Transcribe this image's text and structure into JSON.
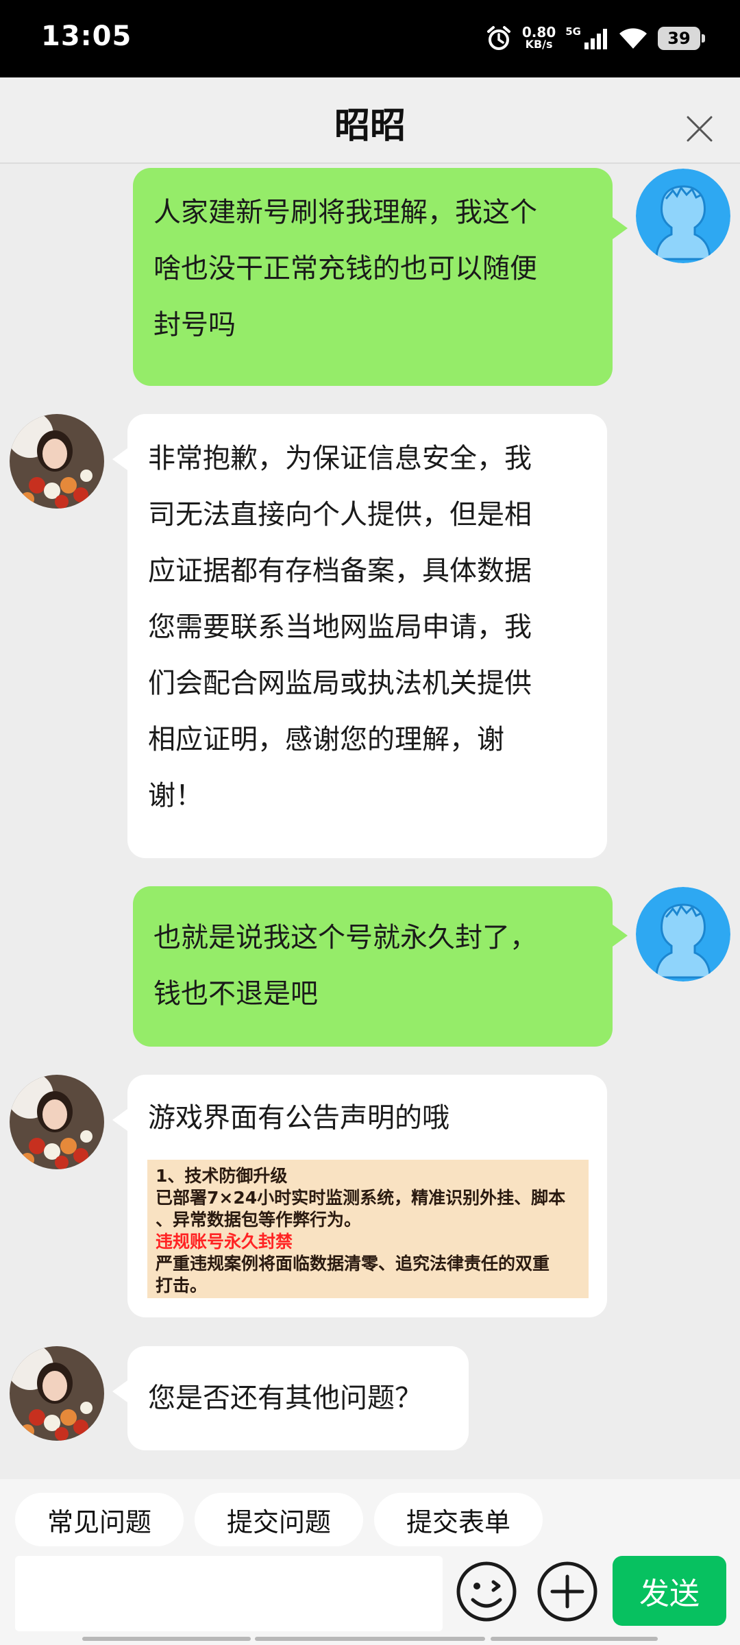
{
  "status_bar": {
    "time": "13:05",
    "net_speed_value": "0.80",
    "net_speed_unit": "KB/s",
    "network_type": "5G",
    "battery": "39"
  },
  "header": {
    "title": "昭昭"
  },
  "messages": [
    {
      "side": "me",
      "lines": [
        "人家建新号刷将我理解，我这个",
        "啥也没干正常充钱的也可以随便",
        "封号吗"
      ]
    },
    {
      "side": "them",
      "lines": [
        "非常抱歉，为保证信息安全，我",
        "司无法直接向个人提供，但是相",
        "应证据都有存档备案，具体数据",
        "您需要联系当地网监局申请，我",
        "们会配合网监局或执法机关提供",
        "相应证明，感谢您的理解，谢",
        "谢！"
      ]
    },
    {
      "side": "me",
      "lines": [
        "也就是说我这个号就永久封了，",
        "钱也不退是吧"
      ]
    },
    {
      "side": "them",
      "lines": [
        "游戏界面有公告声明的哦"
      ],
      "notice": {
        "line1": "1、技术防御升级",
        "line2": "已部署7×24小时实时监测系统，精准识别外挂、脚本",
        "line3": "、异常数据包等作弊行为。",
        "line4": "违规账号永久封禁",
        "line5": "严重违规案例将面临数据清零、追究法律责任的双重",
        "line6": "打击。"
      }
    },
    {
      "side": "them",
      "lines": [
        "您是否还有其他问题？"
      ]
    }
  ],
  "quick_actions": [
    "常见问题",
    "提交问题",
    "提交表单"
  ],
  "composer": {
    "send_label": "发送",
    "emoji_icon": "emoji-icon",
    "plus_icon": "plus-icon"
  },
  "colors": {
    "my_bubble": "#95ec69",
    "their_bubble": "#ffffff",
    "send_button": "#07c160",
    "background": "#ededed"
  }
}
